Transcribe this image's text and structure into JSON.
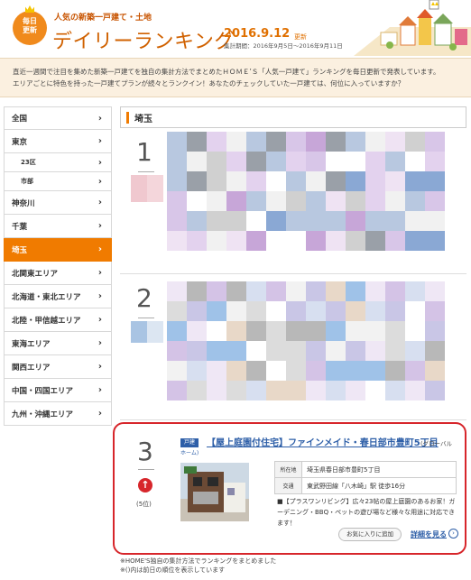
{
  "header": {
    "badge_line1": "毎日",
    "badge_line2": "更新",
    "subtitle": "人気の新築一戸建て・土地",
    "title": "デイリーランキング",
    "date": "2016.9.12",
    "updated": "更新",
    "period": "集計期間：2016年9月5日〜2016年9月11日"
  },
  "intro": {
    "line1": "直近一週間で注目を集めた新築一戸建てを独自の集計方法でまとめたＨＯＭＥ’Ｓ「人気一戸建て」ランキングを毎日更新で発表しています。",
    "line2": "エリアごとに特色を持った一戸建てプランが続々とランクイン！あなたのチェックしていた一戸建ては、何位に入っていますか？"
  },
  "sidebar": {
    "items": [
      {
        "label": "全国",
        "arrow": "›",
        "sub": false,
        "active": false
      },
      {
        "label": "東京",
        "arrow": "›",
        "sub": false,
        "active": false
      },
      {
        "label": "23区",
        "arrow": "›",
        "sub": true,
        "active": false
      },
      {
        "label": "市部",
        "arrow": "›",
        "sub": true,
        "active": false
      },
      {
        "label": "神奈川",
        "arrow": "›",
        "sub": false,
        "active": false
      },
      {
        "label": "千葉",
        "arrow": "›",
        "sub": false,
        "active": false
      },
      {
        "label": "埼玉",
        "arrow": "›",
        "sub": false,
        "active": true
      },
      {
        "label": "北関東エリア",
        "arrow": "›",
        "sub": false,
        "active": false
      },
      {
        "label": "北海道・東北エリア",
        "arrow": "›",
        "sub": false,
        "active": false
      },
      {
        "label": "北陸・甲信越エリア",
        "arrow": "›",
        "sub": false,
        "active": false
      },
      {
        "label": "東海エリア",
        "arrow": "›",
        "sub": false,
        "active": false
      },
      {
        "label": "関西エリア",
        "arrow": "›",
        "sub": false,
        "active": false
      },
      {
        "label": "中国・四国エリア",
        "arrow": "›",
        "sub": false,
        "active": false
      },
      {
        "label": "九州・沖縄エリア",
        "arrow": "›",
        "sub": false,
        "active": false
      }
    ]
  },
  "main": {
    "section_title": "埼玉",
    "rank1": "1",
    "rank2": "2",
    "card": {
      "rank": "3",
      "up_icon": "arrow-up-icon",
      "prev": "(5位)",
      "tag": "戸建",
      "tag2": "ホーム)",
      "title": "【屋上庭園付住宅】ファインメイド・春日部市豊町5丁目",
      "brand": "(グローバル",
      "loc_key": "所在地",
      "loc_val": "埼玉県春日部市豊町5丁目",
      "traffic_key": "交通",
      "traffic_val": "東武野田線「八木崎」駅 徒歩16分",
      "desc": "■【プラスワンリビング】広々23帖の屋上庭園のあるお家！ガーデニング・BBQ・ペットの遊び場など様々な用途に対応できます！",
      "fav_label": "お気に入りに追加",
      "detail_label": "詳細を見る",
      "detail_arrow": "›"
    }
  },
  "notes": {
    "line1": "※HOME'S独自の集計方法でランキングをまとめました",
    "line2": "※()内は前日の順位を表示しています"
  },
  "colors": {
    "accent": "#f07b00",
    "link": "#2e5fa8",
    "highlight_border": "#d7262b"
  }
}
